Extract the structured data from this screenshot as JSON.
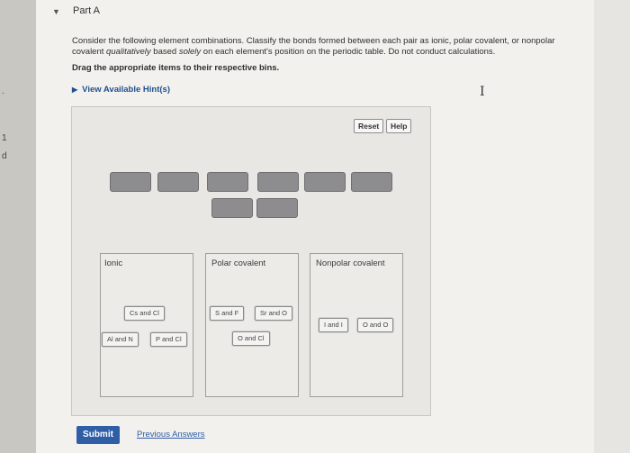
{
  "part": {
    "title": "Part A"
  },
  "question": {
    "pre": "Consider the following element combinations. Classify the bonds formed between each pair as ionic, polar covalent, or nonpolar covalent ",
    "qualitatively": "qualitatively",
    "mid": " based ",
    "solely": "solely",
    "post": " on each element's position on the periodic table. Do not conduct calculations.",
    "instruction": "Drag the appropriate items to their respective bins."
  },
  "hints": {
    "label": "View Available Hint(s)"
  },
  "toolbar": {
    "reset": "Reset",
    "help": "Help"
  },
  "bins": {
    "ionic": {
      "label": "Ionic",
      "items": [
        "Cs and Cl",
        "Al and N",
        "P and Cl"
      ]
    },
    "polar": {
      "label": "Polar covalent",
      "items": [
        "S and F",
        "Sr and O",
        "O and Cl"
      ]
    },
    "nonpolar": {
      "label": "Nonpolar covalent",
      "items": [
        "I and I",
        "O and O"
      ]
    }
  },
  "footer": {
    "submit": "Submit",
    "previous": "Previous Answers"
  },
  "edge": {
    "f1": ".",
    "f2": "1",
    "f3": "d",
    "f4": ""
  }
}
